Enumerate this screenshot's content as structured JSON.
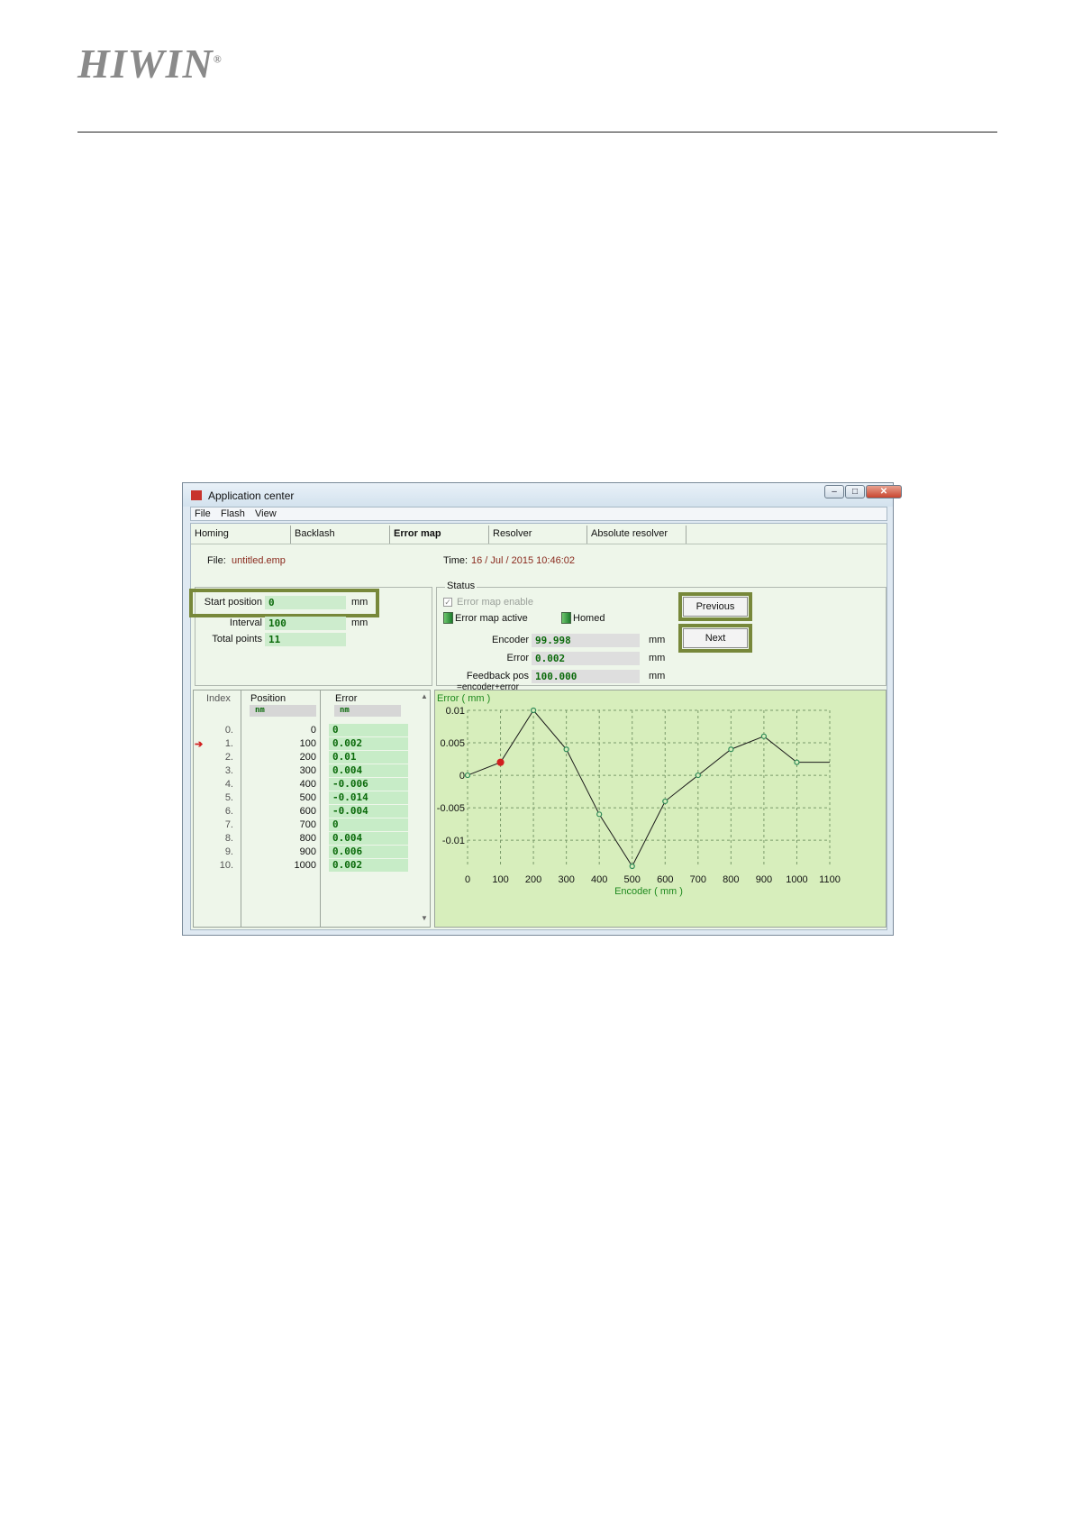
{
  "logo": {
    "text": "HIWIN",
    "mark": "®"
  },
  "window": {
    "title": "Application center",
    "menu": [
      "File",
      "Flash",
      "View"
    ],
    "tabs": [
      "Homing",
      "Backlash",
      "Error map",
      "Resolver",
      "Absolute resolver"
    ],
    "active_tab": "Error map",
    "file_label": "File:",
    "file_name": "untitled.emp",
    "time_label": "Time:",
    "time_value": "16 / Jul / 2015  10:46:02"
  },
  "map_attributes": {
    "start_label": "Start position",
    "start_value": "0",
    "start_unit": "mm",
    "interval_label": "Interval",
    "interval_value": "100",
    "interval_unit": "mm",
    "total_label": "Total points",
    "total_value": "11"
  },
  "status": {
    "group_label": "Status",
    "enable_label": "Error map enable",
    "active_label": "Error map active",
    "homed_label": "Homed",
    "encoder_label": "Encoder",
    "encoder_value": "99.998",
    "encoder_unit": "mm",
    "error_label": "Error",
    "error_value": "0.002",
    "error_unit": "mm",
    "feedback_label": "Feedback pos",
    "feedback_value": "100.000",
    "feedback_unit": "mm",
    "feedback_note": "=encoder+error"
  },
  "buttons": {
    "previous": "Previous",
    "next": "Next"
  },
  "table": {
    "headers": [
      "Index",
      "Position",
      "Error"
    ],
    "units": [
      "nm",
      "nm"
    ],
    "current_index": 1,
    "rows": [
      {
        "index": "0.",
        "position": "0",
        "error": "0"
      },
      {
        "index": "1.",
        "position": "100",
        "error": "0.002"
      },
      {
        "index": "2.",
        "position": "200",
        "error": "0.01"
      },
      {
        "index": "3.",
        "position": "300",
        "error": "0.004"
      },
      {
        "index": "4.",
        "position": "400",
        "error": "-0.006"
      },
      {
        "index": "5.",
        "position": "500",
        "error": "-0.014"
      },
      {
        "index": "6.",
        "position": "600",
        "error": "-0.004"
      },
      {
        "index": "7.",
        "position": "700",
        "error": "0"
      },
      {
        "index": "8.",
        "position": "800",
        "error": "0.004"
      },
      {
        "index": "9.",
        "position": "900",
        "error": "0.006"
      },
      {
        "index": "10.",
        "position": "1000",
        "error": "0.002"
      }
    ]
  },
  "chart_data": {
    "type": "line",
    "title": "",
    "xlabel": "Encoder ( mm )",
    "ylabel": "Error ( mm )",
    "x": [
      0,
      100,
      200,
      300,
      400,
      500,
      600,
      700,
      800,
      900,
      1000,
      1100
    ],
    "series": [
      {
        "values": [
          0,
          0.002,
          0.01,
          0.004,
          -0.006,
          -0.014,
          -0.004,
          0,
          0.004,
          0.006,
          0.002,
          0.002
        ]
      }
    ],
    "highlight_x": 100,
    "xlim": [
      0,
      1100
    ],
    "ylim": [
      -0.014,
      0.01
    ],
    "xticks": [
      "0",
      "100",
      "200",
      "300",
      "400",
      "500",
      "600",
      "700",
      "800",
      "900",
      "1000",
      "1100"
    ],
    "yticks": [
      "0.01",
      "0.005",
      "0",
      "-0.005",
      "-0.01"
    ],
    "grid": true,
    "colors": {
      "background": "#d7eebc",
      "line": "#1a1a1a",
      "marker": "#2e8b57",
      "highlight": "#d11f1f",
      "label": "#1f8a1f"
    }
  }
}
